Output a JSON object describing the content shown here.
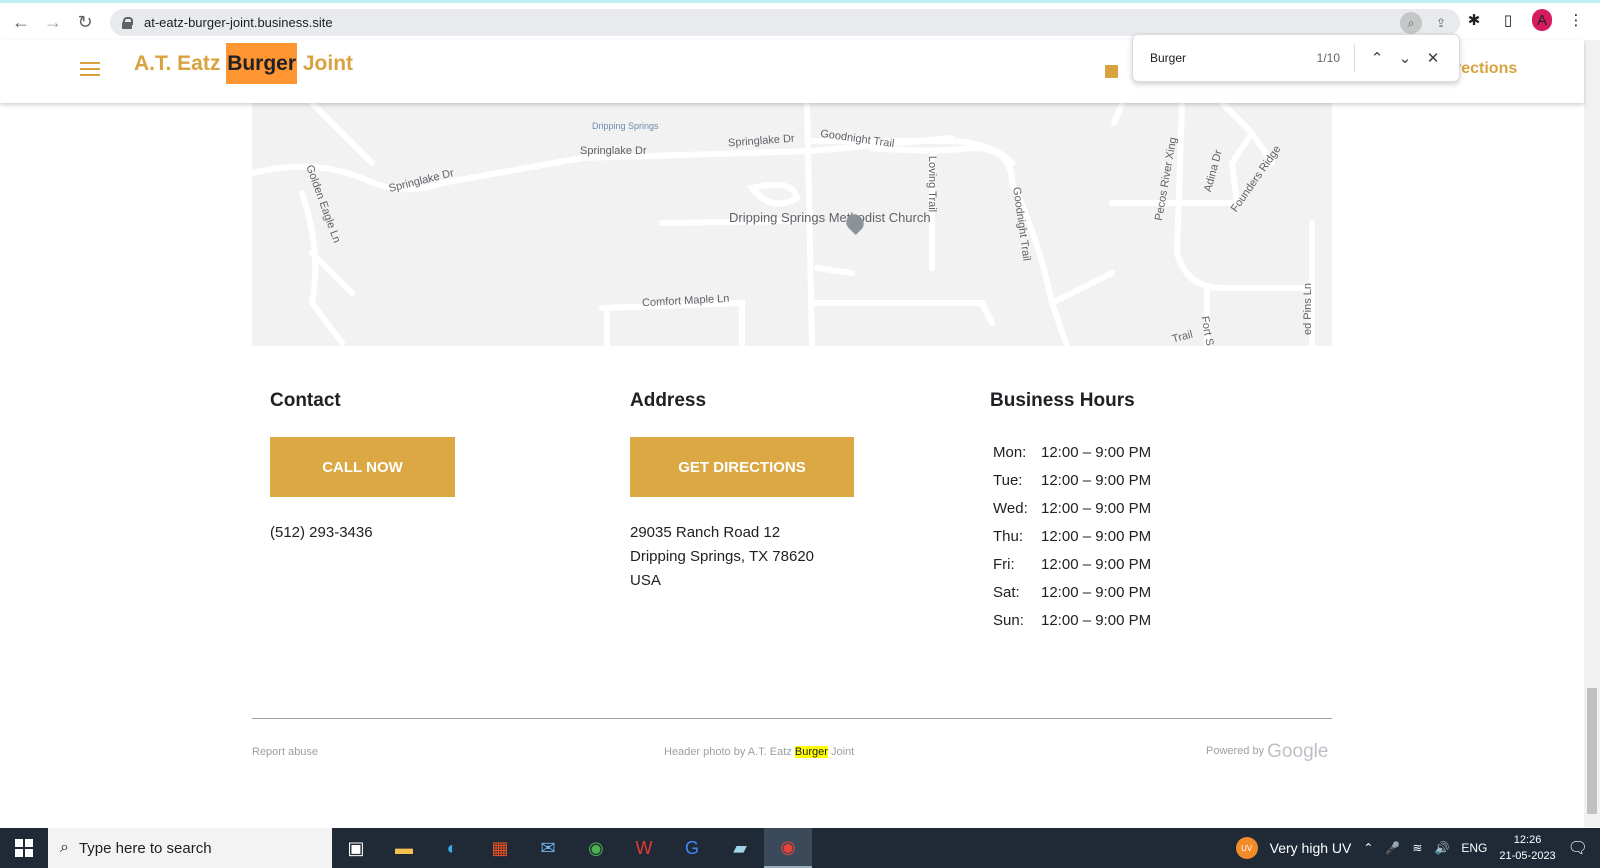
{
  "browser": {
    "url": "at-eatz-burger-joint.business.site",
    "find": {
      "query": "Burger",
      "count": "1/10"
    },
    "avatar": "A"
  },
  "site": {
    "brand_before": "A.T. Eatz ",
    "brand_highlight": "Burger",
    "brand_after": " Joint",
    "header_link": "rections"
  },
  "map": {
    "labels": [
      "Dripping Springs",
      "Springlake Dr",
      "Springlake Dr",
      "Goodnight Trail",
      "Golden Eagle Ln",
      "Springlake Dr",
      "Loving Trail",
      "Goodnight Trail",
      "Pecos River Xing",
      "Adina Dr",
      "Founders Ridge",
      "Dripping Springs Methodist Church",
      "Comfort Maple Ln",
      "Trail",
      "Fort S",
      "ed Pins Ln"
    ]
  },
  "contact": {
    "heading": "Contact",
    "button": "CALL NOW",
    "phone": "(512) 293-3436"
  },
  "address": {
    "heading": "Address",
    "button": "GET DIRECTIONS",
    "line1": "29035 Ranch Road 12",
    "line2": "Dripping Springs, TX 78620",
    "line3": "USA"
  },
  "hours": {
    "heading": "Business Hours",
    "days": [
      {
        "day": "Mon:",
        "time": "12:00 – 9:00 PM"
      },
      {
        "day": "Tue:",
        "time": "12:00 – 9:00 PM"
      },
      {
        "day": "Wed:",
        "time": "12:00 – 9:00 PM"
      },
      {
        "day": "Thu:",
        "time": "12:00 – 9:00 PM"
      },
      {
        "day": "Fri:",
        "time": "12:00 – 9:00 PM"
      },
      {
        "day": "Sat:",
        "time": "12:00 – 9:00 PM"
      },
      {
        "day": "Sun:",
        "time": "12:00 – 9:00 PM"
      }
    ]
  },
  "footer": {
    "report": "Report abuse",
    "photo_before": "Header photo by A.T. Eatz ",
    "photo_highlight": "Burger",
    "photo_after": " Joint",
    "powered": "Powered by",
    "google": "Google"
  },
  "taskbar": {
    "search_placeholder": "Type here to search",
    "weather": "Very high UV",
    "uv_badge": "UV",
    "lang": "ENG",
    "time": "12:26",
    "date": "21-05-2023"
  },
  "colors": {
    "gold": "#dba843",
    "find_highlight": "#ff9632",
    "footer_highlight": "#ffff00"
  }
}
